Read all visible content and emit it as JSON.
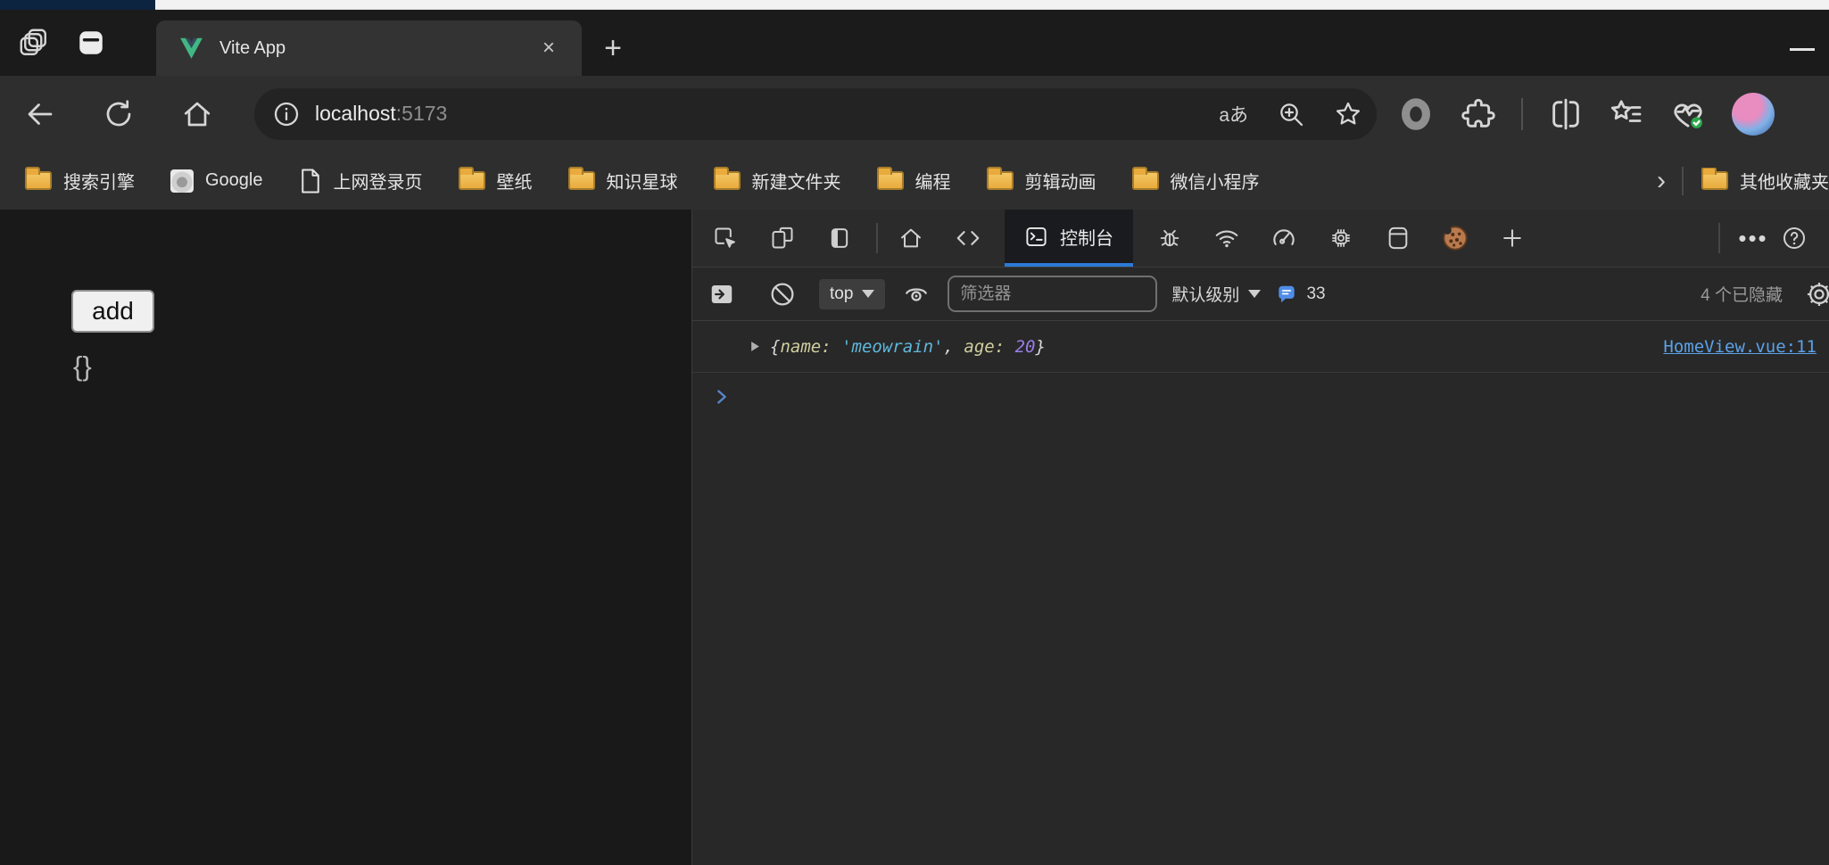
{
  "window": {
    "minimize_glyph": "—"
  },
  "tab_bar": {
    "active_tab_title": "Vite App",
    "close_glyph": "×",
    "new_tab_glyph": "+"
  },
  "nav": {
    "url_host": "localhost",
    "url_port": ":5173",
    "text_size_glyph": "aあ"
  },
  "bookmarks": {
    "items": [
      {
        "label": "搜索引擎",
        "icon": "folder-icon"
      },
      {
        "label": "Google",
        "icon": "google-favicon"
      },
      {
        "label": "上网登录页",
        "icon": "page-icon"
      },
      {
        "label": "壁纸",
        "icon": "folder-icon"
      },
      {
        "label": "知识星球",
        "icon": "folder-icon"
      },
      {
        "label": "新建文件夹",
        "icon": "folder-icon"
      },
      {
        "label": "编程",
        "icon": "folder-icon"
      },
      {
        "label": "剪辑动画",
        "icon": "folder-icon"
      },
      {
        "label": "微信小程序",
        "icon": "folder-icon"
      }
    ],
    "overflow_glyph": "›",
    "other_favorites_label": "其他收藏夹"
  },
  "page": {
    "add_button_label": "add",
    "object_text": "{}"
  },
  "devtools": {
    "console_tab_label": "控制台",
    "more_options_glyph": "•••",
    "toolbar": {
      "context_selector": "top",
      "filter_placeholder": "筛选器",
      "log_level": "默认级别",
      "message_count": "33",
      "hidden_count": "4 个已隐藏"
    },
    "console_message": {
      "open_brace": "{",
      "key1": "name:",
      "sep1": " ",
      "string_value": "'meowrain'",
      "comma": ", ",
      "key2": "age:",
      "sep2": " ",
      "number_value": "20",
      "close_brace": "}",
      "source_link": "HomeView.vue:11"
    }
  },
  "colors": {
    "accent_blue": "#2c7ad6",
    "link_blue": "#5ca1e8",
    "string_cyan": "#5fb8dc",
    "number_purple": "#9a7ee8",
    "key_yellow": "#cfcf9f",
    "folder_yellow": "#e9ab3c",
    "vue_green": "#41b883",
    "bubble_blue": "#4f8ee8"
  }
}
